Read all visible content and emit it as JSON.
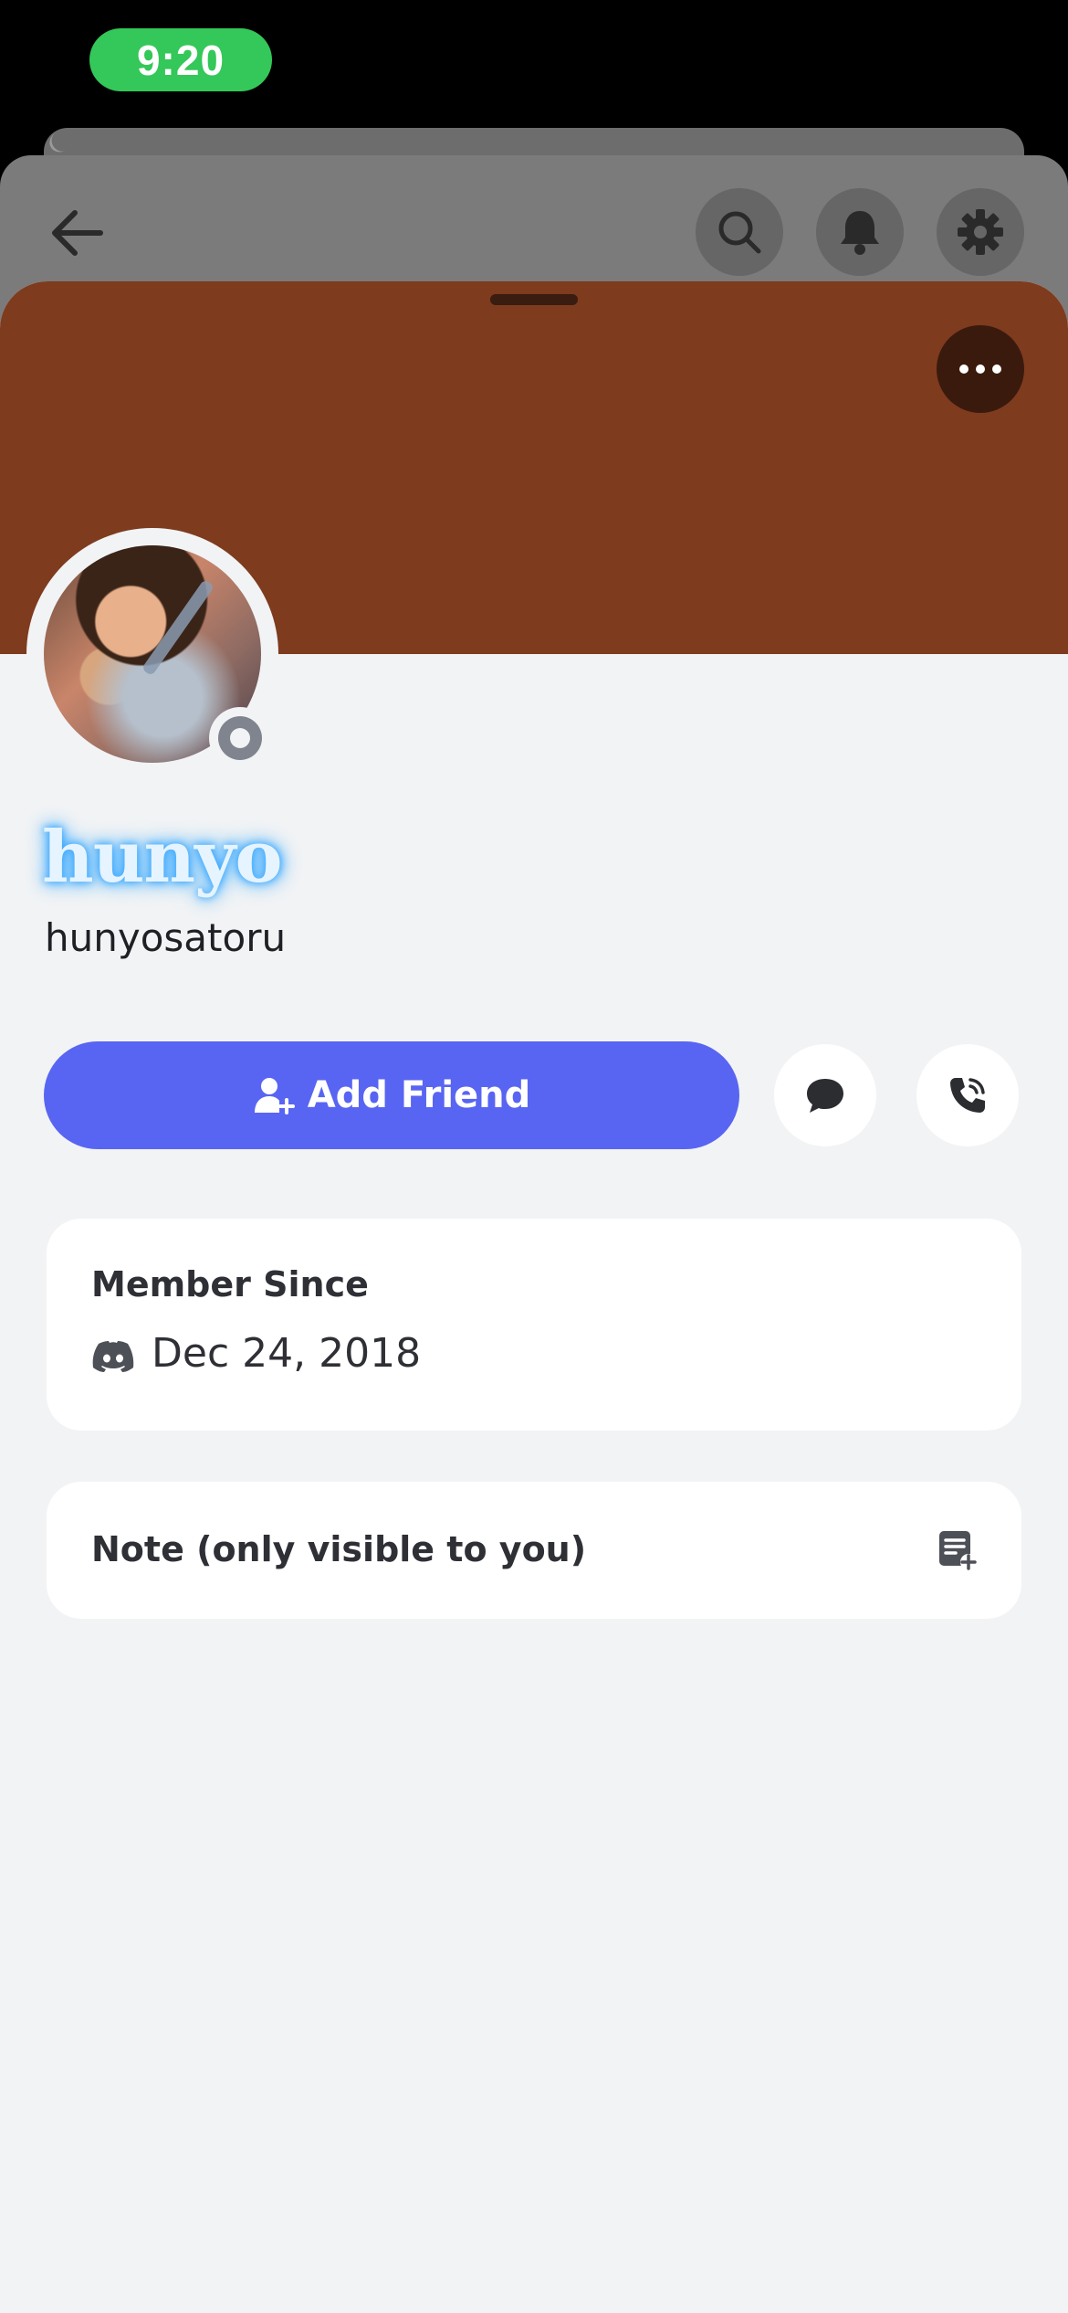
{
  "status_bar": {
    "time": "9:20"
  },
  "profile": {
    "display_name": "hunyo",
    "username": "hunyosatoru",
    "status": "offline",
    "banner_color": "#7e3b1e"
  },
  "actions": {
    "add_friend_label": "Add Friend",
    "message_icon": "chat-bubble-icon",
    "call_icon": "phone-call-icon"
  },
  "member_since": {
    "title": "Member Since",
    "date": "Dec 24, 2018",
    "icon": "discord-icon"
  },
  "note": {
    "label": "Note (only visible to you)",
    "icon": "add-note-icon"
  },
  "colors": {
    "accent": "#5865f2",
    "status_offline": "#80848e",
    "status_time_pill": "#34c759"
  }
}
